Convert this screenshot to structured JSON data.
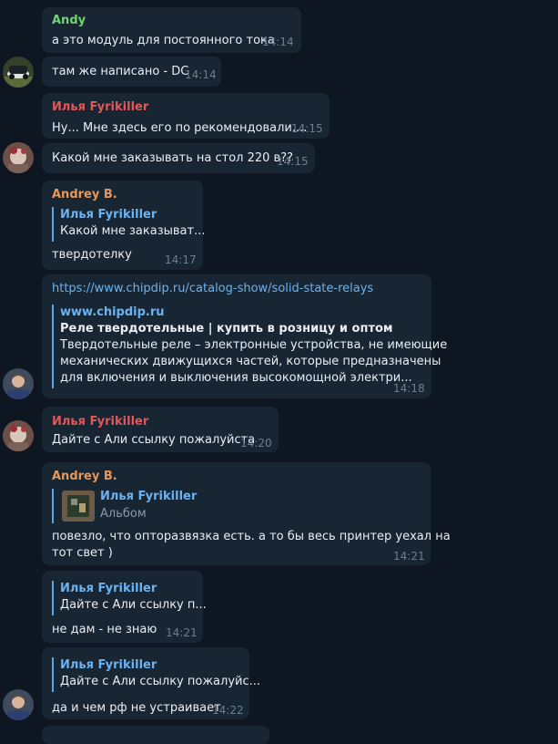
{
  "colors": {
    "background": "#0e1621",
    "bubble": "#182533",
    "link": "#6ab3f3",
    "name_andy": "#6fd46f",
    "name_ilya": "#e0585a",
    "name_andrey": "#e6985a",
    "time": "#6d7f8f"
  },
  "messages": [
    {
      "sender": "Andy",
      "text": "а это модуль для постоянного тока",
      "time": "14:14"
    },
    {
      "text": "там же написано - DC",
      "time": "14:14"
    },
    {
      "sender": "Илья Fyrikiller",
      "text": "Ну... Мне здесь его по рекомендовали....",
      "time": "14:15"
    },
    {
      "text": "Какой мне заказывать на стол 220 в??",
      "time": "14:15"
    },
    {
      "sender": "Andrey B.",
      "quote_name": "Илья Fyrikiller",
      "quote_text": "Какой мне заказыват...",
      "text": "твердотелку",
      "time": "14:17"
    },
    {
      "link": "https://www.chipdip.ru/catalog-show/solid-state-relays",
      "preview_site": "www.chipdip.ru",
      "preview_title": "Реле твердотельные | купить в розницу и оптом",
      "preview_lines": [
        "Твердотельные реле – электронные устройства, не имеющие",
        "механических движущихся частей, которые предназначены",
        "для включения и выключения высокомощной электри..."
      ],
      "time": "14:18"
    },
    {
      "sender": "Илья Fyrikiller",
      "text": "Дайте с Али ссылку пожалуйста",
      "time": "14:20"
    },
    {
      "sender": "Andrey B.",
      "quote_name": "Илья Fyrikiller",
      "quote_text": "Альбом",
      "text_lines": [
        "повезло, что опторазвязка есть. а то бы весь принтер уехал на",
        "тот свет )"
      ],
      "time": "14:21"
    },
    {
      "quote_name": "Илья Fyrikiller",
      "quote_text": "Дайте с Али ссылку п...",
      "text": "не дам - не знаю",
      "time": "14:21"
    },
    {
      "quote_name": "Илья Fyrikiller",
      "quote_text": "Дайте с Али ссылку пожалуйс...",
      "text": "да и чем рф не устраивает",
      "time": "14:22"
    }
  ]
}
